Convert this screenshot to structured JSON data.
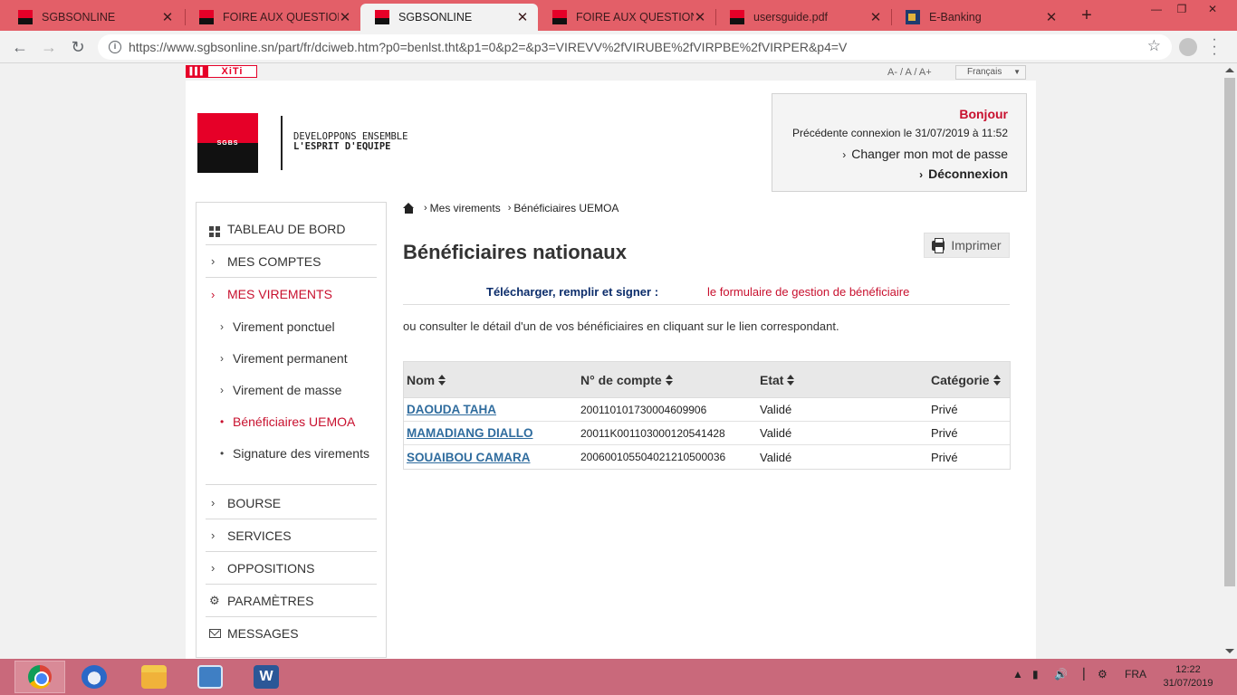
{
  "browser": {
    "tabs": [
      {
        "title": "SGBSONLINE",
        "icon": "sgbs-favicon",
        "active": false
      },
      {
        "title": "FOIRE AUX QUESTIONS",
        "icon": "sgbs-favicon",
        "active": false
      },
      {
        "title": "SGBSONLINE",
        "icon": "sgbs-favicon",
        "active": true
      },
      {
        "title": "FOIRE AUX QUESTIONS",
        "icon": "sgbs-favicon",
        "active": false
      },
      {
        "title": "usersguide.pdf",
        "icon": "pdf-favicon",
        "active": false
      },
      {
        "title": "E-Banking",
        "icon": "ebanking-favicon",
        "active": false
      }
    ],
    "close_glyph": "✕",
    "new_tab_glyph": "+",
    "url": "https://www.sgbsonline.sn/part/fr/dciweb.htm?p0=benlst.tht&p1=0&p2=&p3=VIREVV%2fVIRUBE%2fVIRPBE%2fVIRPER&p4=V"
  },
  "top": {
    "xiti_label": "XiTi",
    "font_size_controls": "A- / A / A+",
    "language": "Français"
  },
  "brand": {
    "logo_text": "SGBS",
    "tagline_line1": "DEVELOPPONS ENSEMBLE",
    "tagline_line2": "L'ESPRIT D'EQUIPE",
    "colors": {
      "red": "#e60028",
      "black": "#111111",
      "accent_text": "#c8102e",
      "navy": "#0c2d6b",
      "link_blue": "#2f6c9e"
    }
  },
  "welcome": {
    "greeting": "Bonjour",
    "last_connection": "Précédente connexion  le 31/07/2019 à 11:52",
    "change_password": "Changer mon mot de passe",
    "logout": "Déconnexion"
  },
  "sidebar": {
    "dashboard": "TABLEAU DE BORD",
    "accounts": "MES COMPTES",
    "transfers": "MES VIREMENTS",
    "transfer_items": [
      {
        "label": "Virement ponctuel",
        "active": false
      },
      {
        "label": "Virement permanent",
        "active": false
      },
      {
        "label": "Virement de masse",
        "active": false
      },
      {
        "label": "Bénéficiaires UEMOA",
        "active": true
      },
      {
        "label": "Signature des virements",
        "active": false
      }
    ],
    "stock": "BOURSE",
    "services": "SERVICES",
    "oppositions": "OPPOSITIONS",
    "settings": "PARAMÈTRES",
    "messages": "MESSAGES"
  },
  "breadcrumb": {
    "items": [
      "Mes virements",
      "Bénéficiaires UEMOA"
    ]
  },
  "main": {
    "title": "Bénéficiaires nationaux",
    "print_label": "Imprimer",
    "download_label": "Télécharger, remplir et signer :",
    "download_link": "le formulaire de gestion de bénéficiaire",
    "intro": "ou consulter le détail d'un de vos bénéficiaires en cliquant sur le lien correspondant."
  },
  "table": {
    "headers": [
      "Nom",
      "N° de compte",
      "Etat",
      "Catégorie"
    ],
    "rows": [
      {
        "name": "DAOUDA TAHA",
        "account": "200110101730004609906",
        "status": "Validé",
        "category": "Privé"
      },
      {
        "name": "MAMADIANG DIALLO",
        "account": "20011K001103000120541428",
        "status": "Validé",
        "category": "Privé"
      },
      {
        "name": "SOUAIBOU CAMARA",
        "account": "200600105504021210500036",
        "status": "Validé",
        "category": "Privé"
      }
    ]
  },
  "taskbar": {
    "apps": [
      "chrome-icon",
      "thunderbird-icon",
      "file-explorer-icon",
      "network-app-icon",
      "word-icon"
    ],
    "language": "FRA",
    "time": "12:22",
    "date": "31/07/2019"
  }
}
